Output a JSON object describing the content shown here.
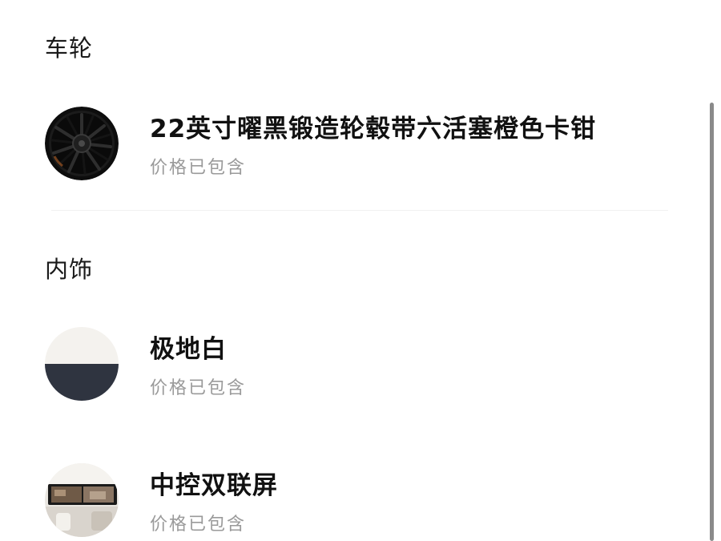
{
  "sections": [
    {
      "title": "车轮",
      "items": [
        {
          "name": "22英寸曜黑锻造轮毂带六活塞橙色卡钳",
          "price_note": "价格已包含",
          "thumbnail": "wheel-image"
        }
      ]
    },
    {
      "title": "内饰",
      "items": [
        {
          "name": "极地白",
          "price_note": "价格已包含",
          "thumbnail": "interior-color-swatch"
        },
        {
          "name": "中控双联屏",
          "price_note": "价格已包含",
          "thumbnail": "dual-screen-image"
        }
      ]
    }
  ],
  "colors": {
    "text_primary": "#111111",
    "text_secondary": "#9a9a9a",
    "swatch_top": "#f4f2ee",
    "swatch_bottom": "#2f3440",
    "scrollbar": "#8a8a8a"
  }
}
